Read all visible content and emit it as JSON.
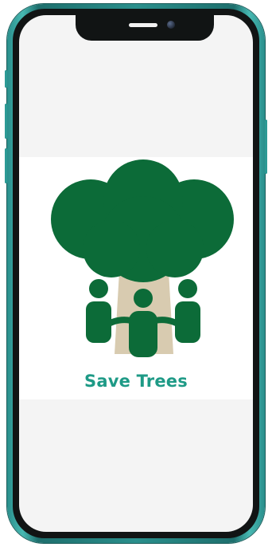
{
  "app": {
    "brand_name": "Save Trees"
  },
  "icons": {
    "logo": "tree-with-people-logo"
  },
  "colors": {
    "frame_teal": "#2a8f8c",
    "tree_green": "#0c6b38",
    "trunk_beige": "#d8cbb0",
    "brand_text": "#1e9a86",
    "screen_bg": "#f4f4f4"
  }
}
